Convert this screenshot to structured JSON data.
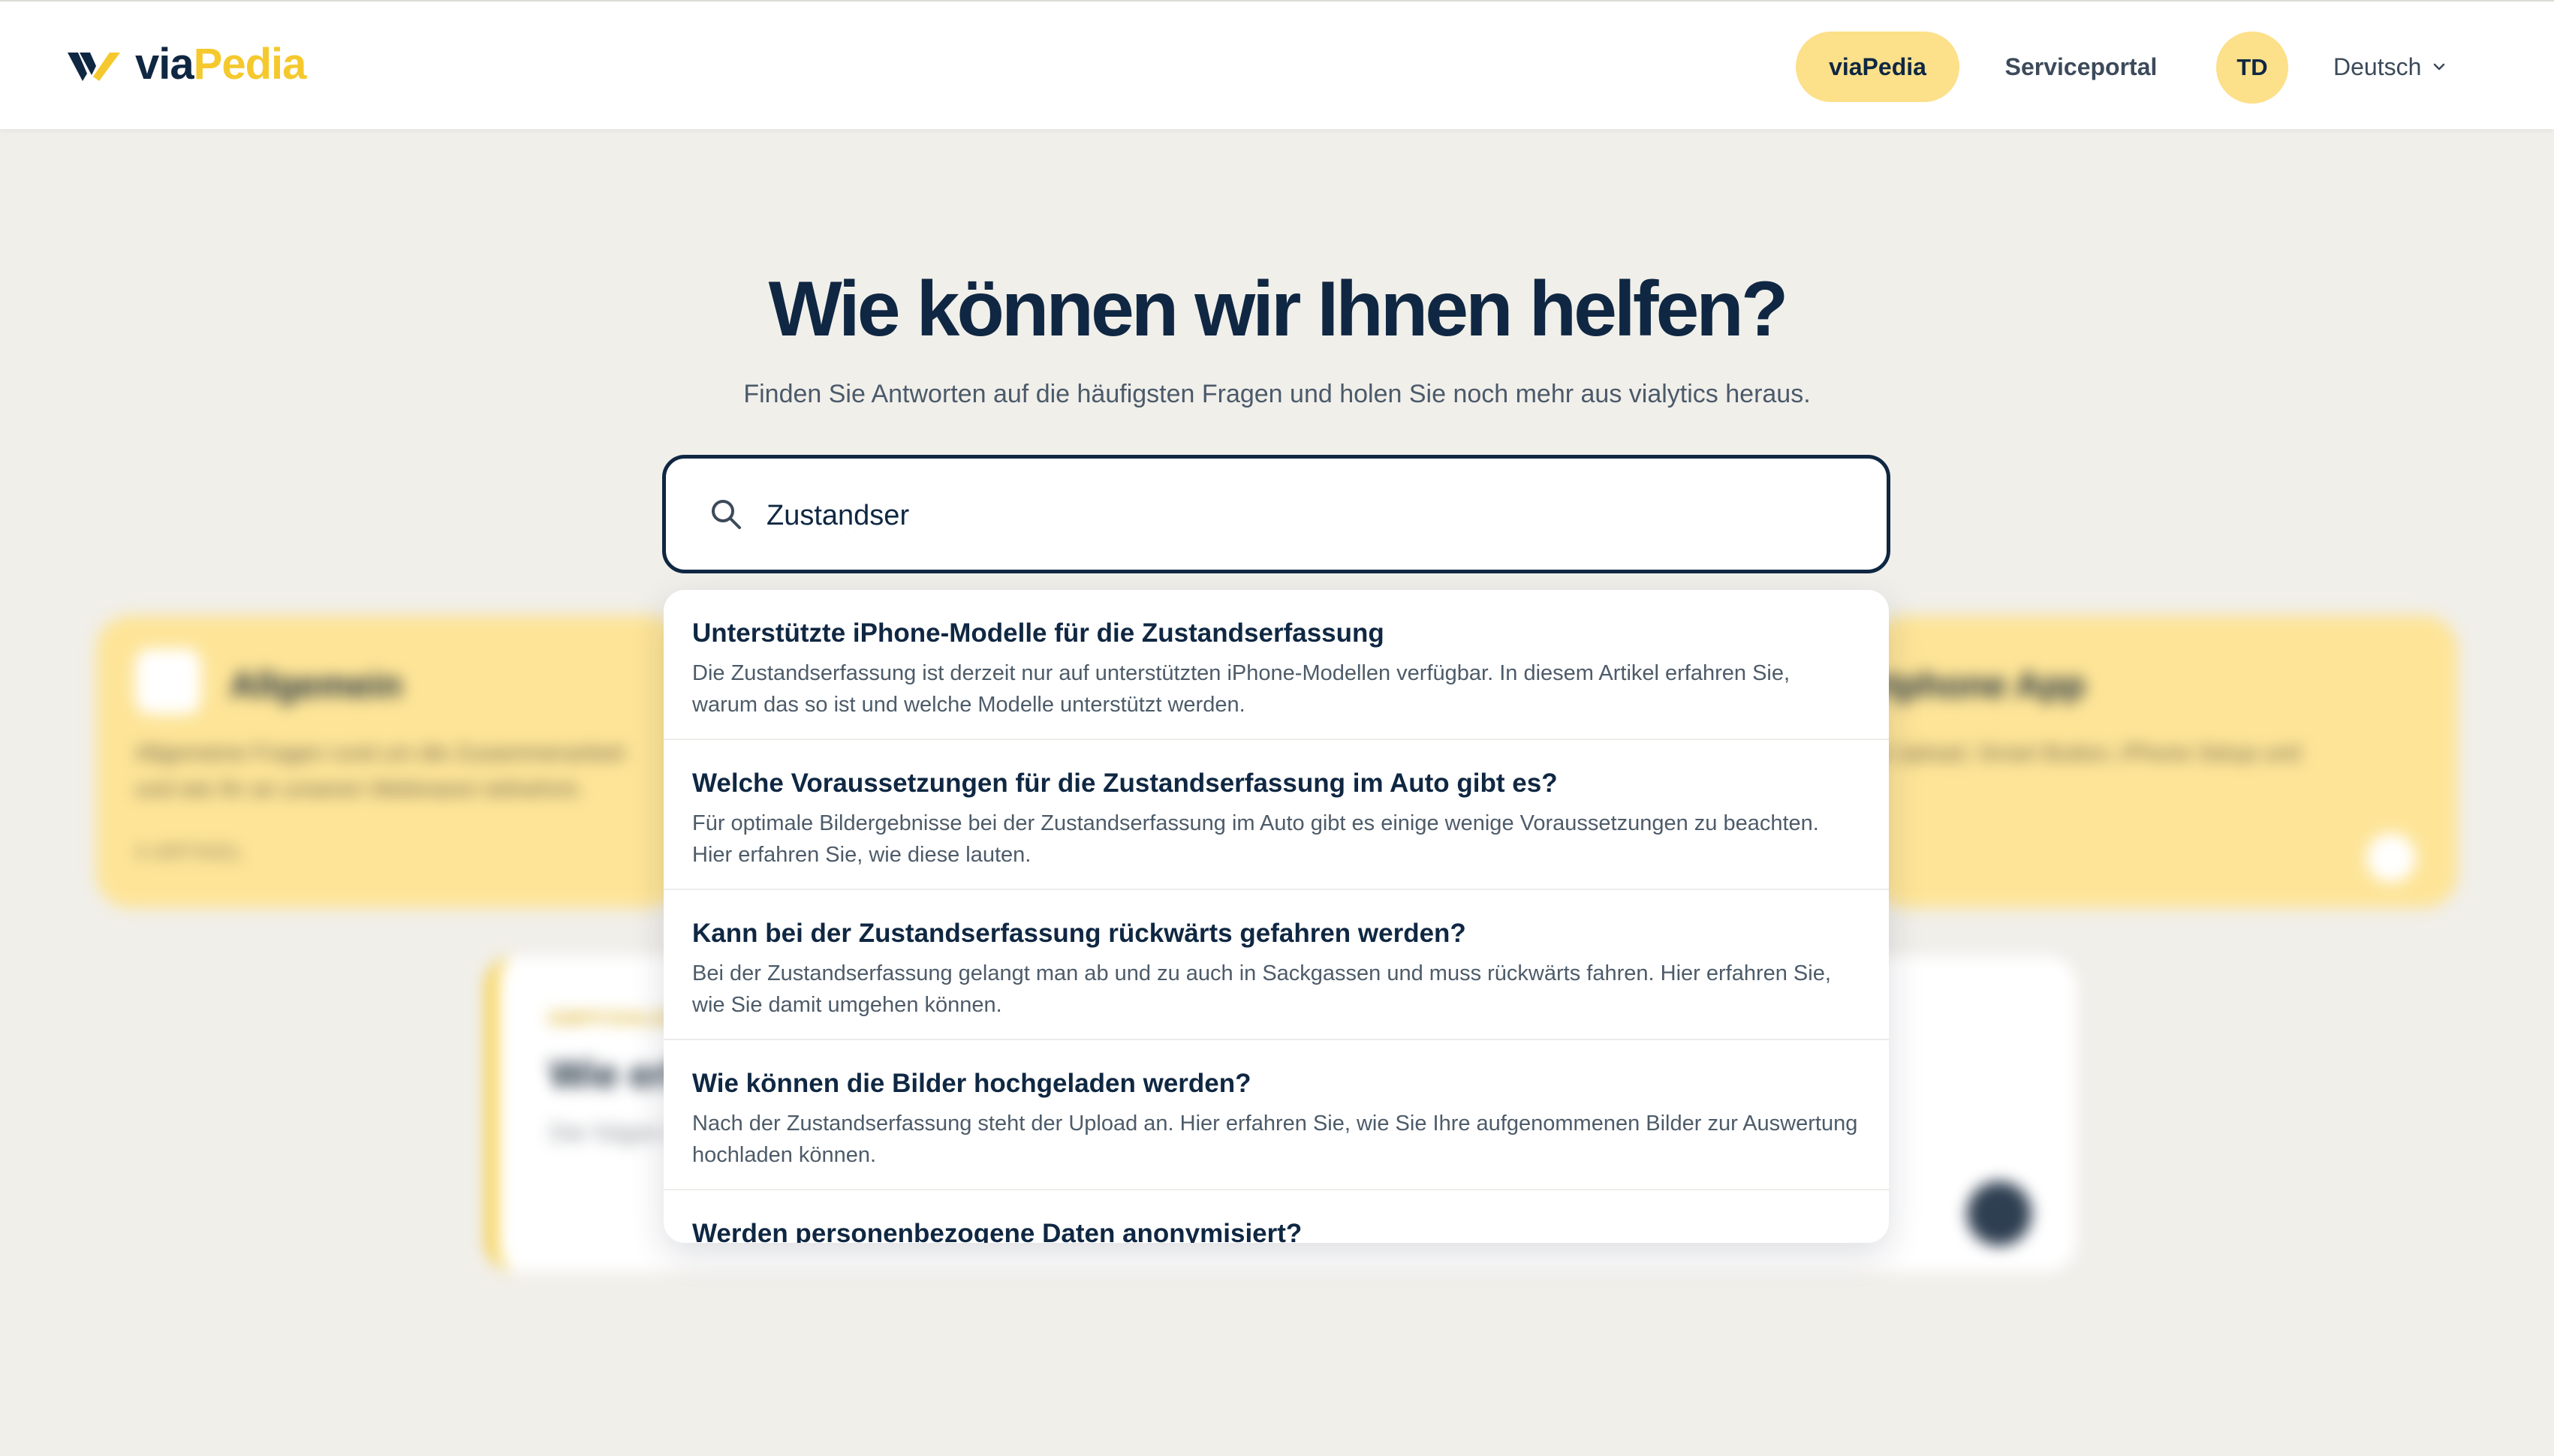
{
  "header": {
    "logo_via": "via",
    "logo_pedia": "Pedia",
    "nav_active": "viaPedia",
    "nav_link": "Serviceportal",
    "avatar_initials": "TD",
    "language": "Deutsch"
  },
  "hero": {
    "title": "Wie können wir Ihnen helfen?",
    "subtitle": "Finden Sie Antworten auf die häufigsten Fragen und holen Sie noch mehr aus vialytics heraus."
  },
  "search": {
    "value": "Zustandser"
  },
  "results": [
    {
      "title": "Unterstützte iPhone-Modelle für die Zustandserfassung",
      "description": "Die Zustandserfassung ist derzeit nur auf unterstützten iPhone-Modellen verfügbar. In diesem Artikel erfahren Sie, warum das so ist und welche Modelle unterstützt werden."
    },
    {
      "title": "Welche Voraussetzungen für die Zustandserfassung im Auto gibt es?",
      "description": "Für optimale Bildergebnisse bei der Zustandserfassung im Auto gibt es einige wenige Voraussetzungen zu beachten. Hier erfahren Sie, wie diese lauten."
    },
    {
      "title": "Kann bei der Zustandserfassung rückwärts gefahren werden?",
      "description": "Bei der Zustandserfassung gelangt man ab und zu auch in Sackgassen und muss rückwärts fahren. Hier erfahren Sie, wie Sie damit umgehen können."
    },
    {
      "title": "Wie können die Bilder hochgeladen werden?",
      "description": "Nach der Zustandserfassung steht der Upload an. Hier erfahren Sie, wie Sie Ihre aufgenommenen Bilder zur Auswertung hochladen können."
    },
    {
      "title": "Werden personenbezogene Daten anonymisiert?",
      "description": ""
    }
  ],
  "background": {
    "category_left_title": "Allgemein",
    "category_left_desc": "Allgemeine Fragen rund um die Zusammenarbeit und wie Ihr an unseren Webinaren teilnehmt.",
    "category_left_count": "4 ARTIKEL",
    "category_right_title": "rtphone App",
    "category_right_desc": "& Upload, Smart Button, iPhone Setup und",
    "article_label": "EMPFOHLEN",
    "article_title": "Wie erh",
    "article_desc": "Der folgen müssen."
  },
  "colors": {
    "brand_navy": "#0f2742",
    "brand_yellow": "#f5c92e",
    "pill_yellow": "#fce08a",
    "page_bg": "#f1efea"
  }
}
